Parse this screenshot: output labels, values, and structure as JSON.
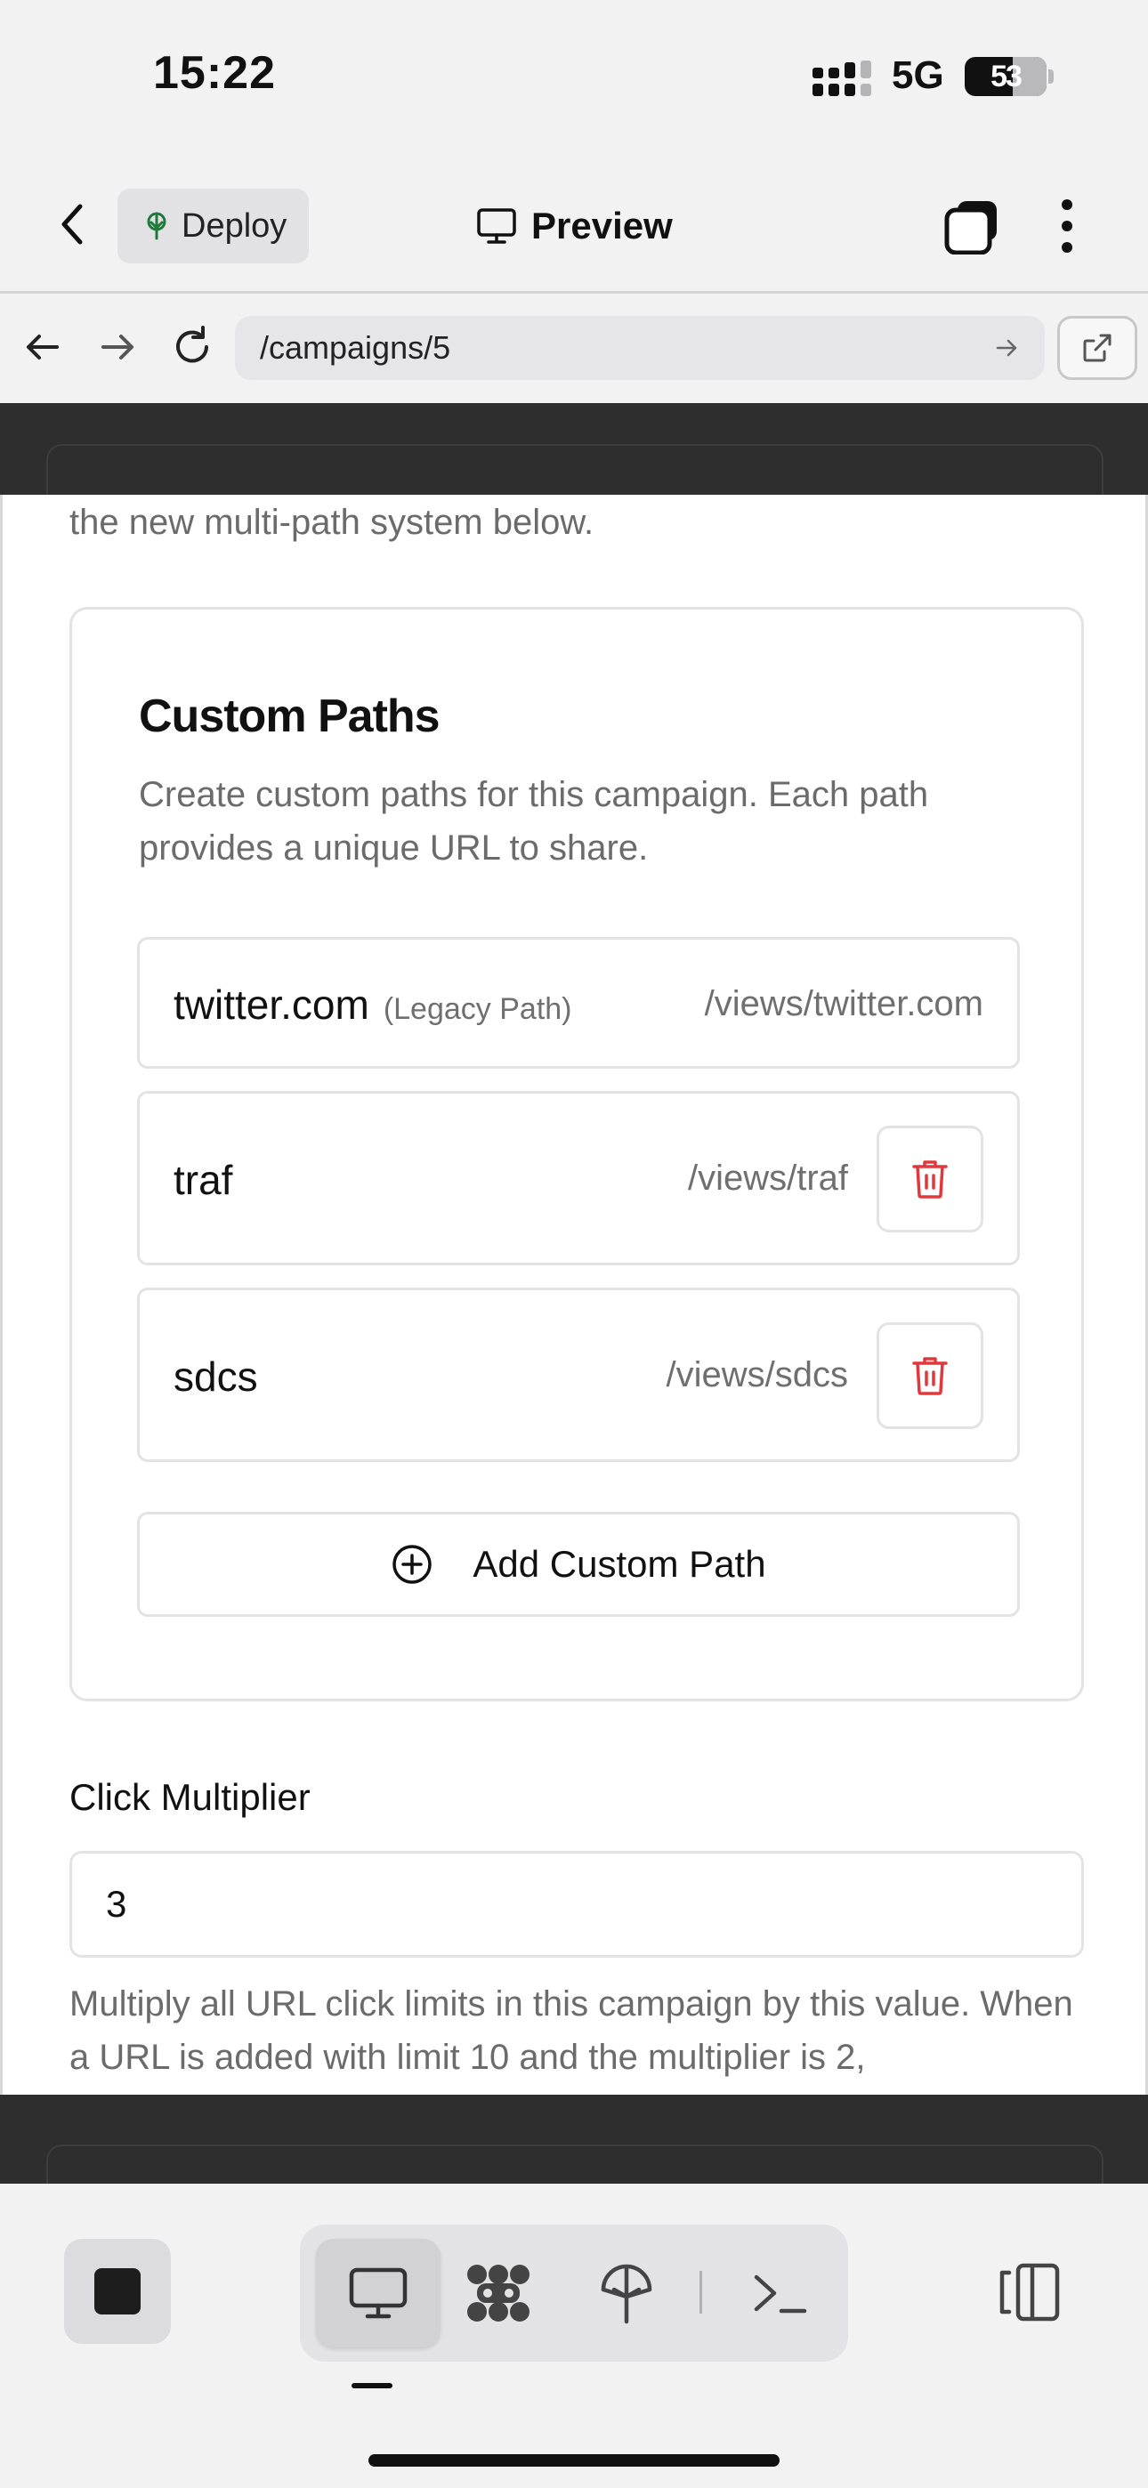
{
  "status_bar": {
    "time": "15:22",
    "network": "5G",
    "battery": "53"
  },
  "header": {
    "deploy_label": "Deploy",
    "preview_label": "Preview"
  },
  "browser": {
    "url": "/campaigns/5"
  },
  "page": {
    "legacy_description_partial": "Legacy custom path for backward compatibility. Consider using the new multi-path system below.",
    "custom_paths": {
      "title": "Custom Paths",
      "description": "Create custom paths for this campaign. Each path provides a unique URL to share.",
      "items": [
        {
          "name": "twitter.com",
          "tag": "(Legacy Path)",
          "url": "/views/twitter.com",
          "deletable": false
        },
        {
          "name": "traf",
          "tag": "",
          "url": "/views/traf",
          "deletable": true
        },
        {
          "name": "sdcs",
          "tag": "",
          "url": "/views/sdcs",
          "deletable": true
        }
      ],
      "add_label": "Add Custom Path"
    },
    "click_multiplier": {
      "label": "Click Multiplier",
      "value": "3",
      "help": "Multiply all URL click limits in this campaign by this value. When a URL is added with limit 10 and the multiplier is 2,"
    }
  },
  "colors": {
    "danger": "#e0383b",
    "text": "#111111",
    "muted": "#6b6b6b",
    "border": "#e3e3e3",
    "frame": "#2e2e2e"
  }
}
